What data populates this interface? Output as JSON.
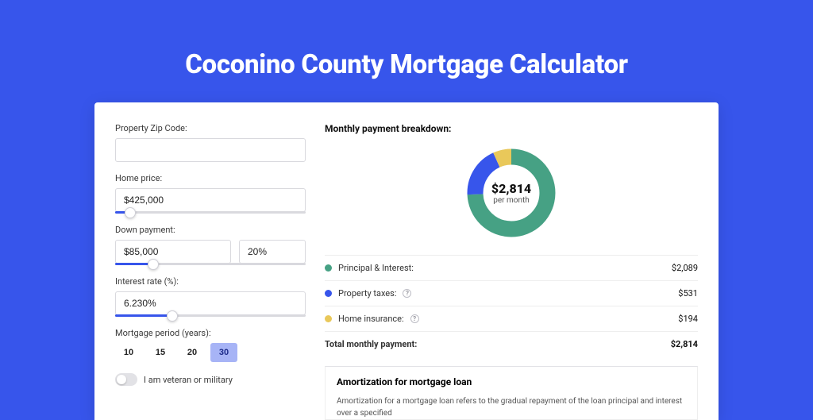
{
  "title": "Coconino County Mortgage Calculator",
  "colors": {
    "accent": "#3755EB",
    "principal": "#46a184",
    "taxes": "#3755EB",
    "insurance": "#e9c85a"
  },
  "form": {
    "zip": {
      "label": "Property Zip Code:",
      "value": ""
    },
    "price": {
      "label": "Home price:",
      "value": "$425,000",
      "slider_pct": 8
    },
    "down": {
      "label": "Down payment:",
      "value": "$85,000",
      "percent_value": "20%",
      "slider_pct": 20
    },
    "rate": {
      "label": "Interest rate (%):",
      "value": "6.230%",
      "slider_pct": 30
    },
    "period": {
      "label": "Mortgage period (years):",
      "options": [
        "10",
        "15",
        "20",
        "30"
      ],
      "selected": "30"
    },
    "veteran": {
      "label": "I am veteran or military",
      "on": false
    }
  },
  "breakdown": {
    "title": "Monthly payment breakdown:",
    "donut": {
      "amount": "$2,814",
      "sub": "per month"
    },
    "rows": [
      {
        "swatch": "g",
        "label": "Principal & Interest:",
        "info": false,
        "value": "$2,089"
      },
      {
        "swatch": "b",
        "label": "Property taxes:",
        "info": true,
        "value": "$531"
      },
      {
        "swatch": "y",
        "label": "Home insurance:",
        "info": true,
        "value": "$194"
      }
    ],
    "total": {
      "label": "Total monthly payment:",
      "value": "$2,814"
    }
  },
  "amortization": {
    "title": "Amortization for mortgage loan",
    "text": "Amortization for a mortgage loan refers to the gradual repayment of the loan principal and interest over a specified"
  },
  "chart_data": {
    "type": "pie",
    "title": "Monthly payment breakdown:",
    "series": [
      {
        "name": "Principal & Interest",
        "value": 2089,
        "color": "#46a184"
      },
      {
        "name": "Property taxes",
        "value": 531,
        "color": "#3755EB"
      },
      {
        "name": "Home insurance",
        "value": 194,
        "color": "#e9c85a"
      }
    ],
    "total": 2814,
    "center_label": "$2,814 per month"
  }
}
